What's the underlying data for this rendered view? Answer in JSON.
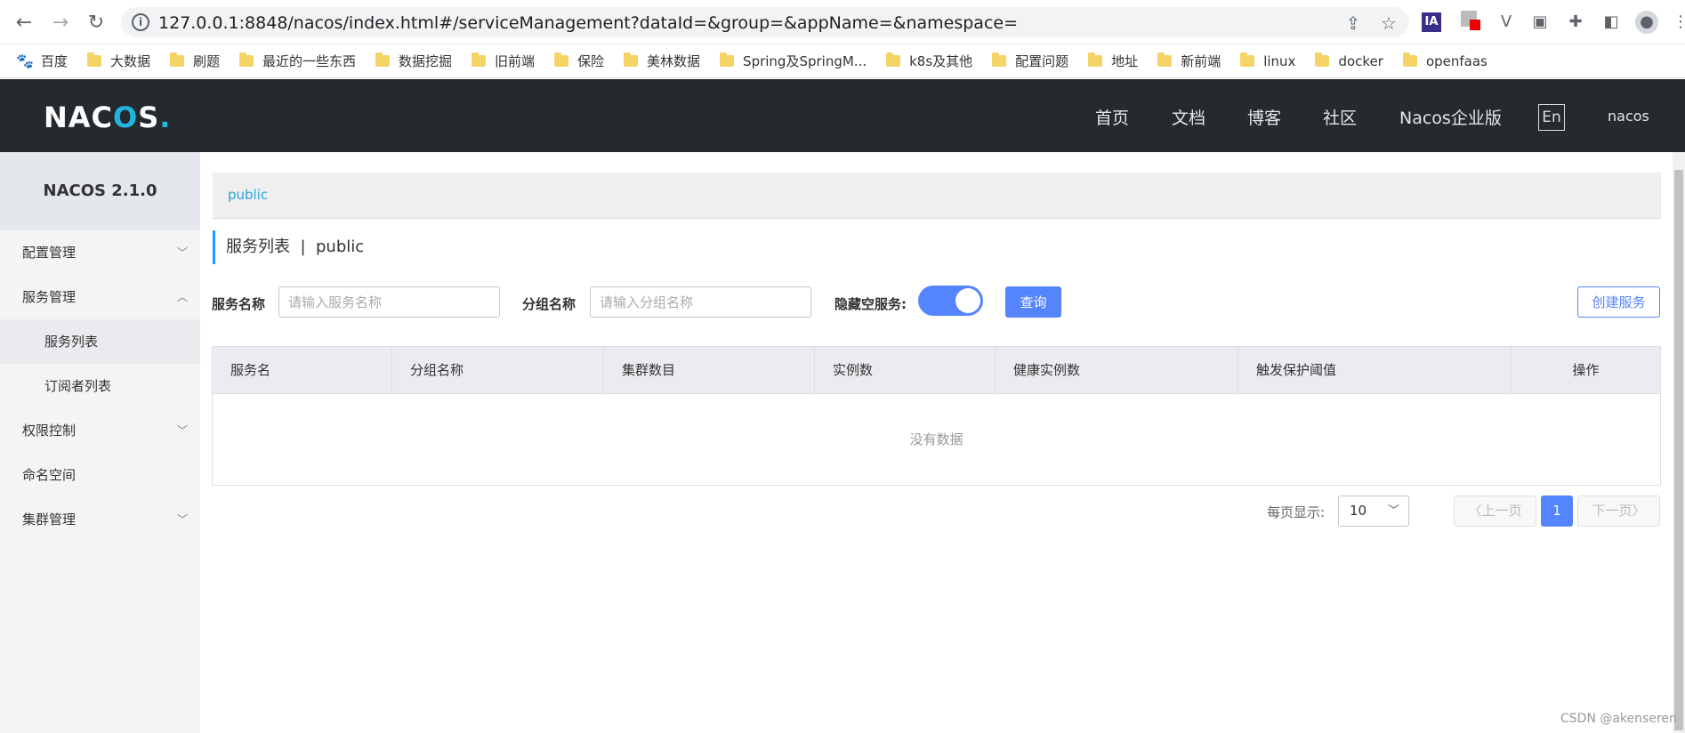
{
  "browser": {
    "url": "127.0.0.1:8848/nacos/index.html#/serviceManagement?dataId=&group=&appName=&namespace=",
    "bookmarks": [
      "百度",
      "大数据",
      "刷题",
      "最近的一些东西",
      "数据挖掘",
      "旧前端",
      "保险",
      "美林数据",
      "Spring及SpringM...",
      "k8s及其他",
      "配置问题",
      "地址",
      "新前端",
      "linux",
      "docker",
      "openfaas"
    ]
  },
  "header": {
    "logo": "NACOS.",
    "nav": [
      "首页",
      "文档",
      "博客",
      "社区",
      "Nacos企业版"
    ],
    "lang": "En",
    "user": "nacos"
  },
  "sidebar": {
    "title": "NACOS 2.1.0",
    "items": [
      "配置管理",
      "服务管理",
      "服务列表",
      "订阅者列表",
      "权限控制",
      "命名空间",
      "集群管理"
    ]
  },
  "main": {
    "namespace": "public",
    "title": "服务列表",
    "title_sep": "|",
    "title_ns": "public",
    "filters": {
      "service_label": "服务名称",
      "service_placeholder": "请输入服务名称",
      "group_label": "分组名称",
      "group_placeholder": "请输入分组名称",
      "hide_empty_label": "隐藏空服务:",
      "hide_empty_on": true,
      "query_button": "查询",
      "create_button": "创建服务"
    },
    "table": {
      "columns": [
        "服务名",
        "分组名称",
        "集群数目",
        "实例数",
        "健康实例数",
        "触发保护阈值",
        "操作"
      ],
      "empty_text": "没有数据"
    },
    "pager": {
      "per_page_label": "每页显示:",
      "per_page": "10",
      "prev": "上一页",
      "current": "1",
      "next": "下一页"
    }
  },
  "watermark": "CSDN @akenseren"
}
